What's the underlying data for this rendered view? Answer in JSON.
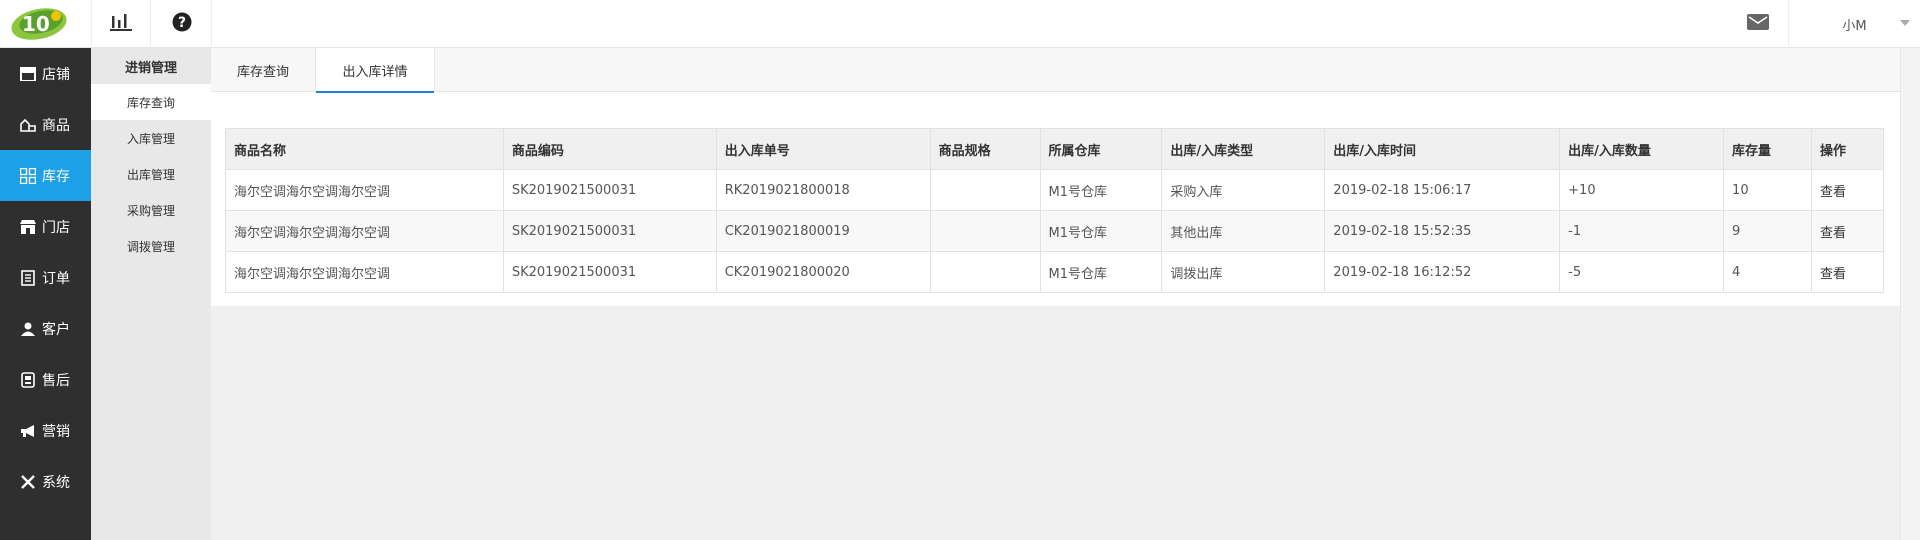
{
  "header": {
    "logo_icon": "brand-logo",
    "stats_icon": "bar-chart-icon",
    "help_icon": "question-icon",
    "mail_icon": "mail-icon",
    "user_name": "小M"
  },
  "sidebar": {
    "accent": "#1ea0e6",
    "items": [
      {
        "label": "店铺",
        "icon": "store-icon"
      },
      {
        "label": "商品",
        "icon": "goods-icon"
      },
      {
        "label": "库存",
        "icon": "grid-icon"
      },
      {
        "label": "门店",
        "icon": "shop-icon"
      },
      {
        "label": "订单",
        "icon": "order-icon"
      },
      {
        "label": "客户",
        "icon": "user-icon"
      },
      {
        "label": "售后",
        "icon": "service-icon"
      },
      {
        "label": "营销",
        "icon": "megaphone-icon"
      },
      {
        "label": "系统",
        "icon": "tools-icon"
      }
    ],
    "active_index": 2
  },
  "submenu": {
    "title": "进销管理",
    "items": [
      "库存查询",
      "入库管理",
      "出库管理",
      "采购管理",
      "调拨管理"
    ]
  },
  "tabs": [
    "库存查询",
    "出入库详情"
  ],
  "table": {
    "headers": [
      "商品名称",
      "商品编码",
      "出入库单号",
      "商品规格",
      "所属仓库",
      "出库/入库类型",
      "出库/入库时间",
      "出库/入库数量",
      "库存量",
      "操作"
    ],
    "rows": [
      [
        "海尔空调海尔空调海尔空调",
        "SK2019021500031",
        "RK2019021800018",
        "",
        "M1号仓库",
        "采购入库",
        "2019-02-18 15:06:17",
        "+10",
        "10",
        "查看"
      ],
      [
        "海尔空调海尔空调海尔空调",
        "SK2019021500031",
        "CK2019021800019",
        "",
        "M1号仓库",
        "其他出库",
        "2019-02-18 15:52:35",
        "-1",
        "9",
        "查看"
      ],
      [
        "海尔空调海尔空调海尔空调",
        "SK2019021500031",
        "CK2019021800020",
        "",
        "M1号仓库",
        "调拨出库",
        "2019-02-18 16:12:52",
        "-5",
        "4",
        "查看"
      ]
    ]
  }
}
